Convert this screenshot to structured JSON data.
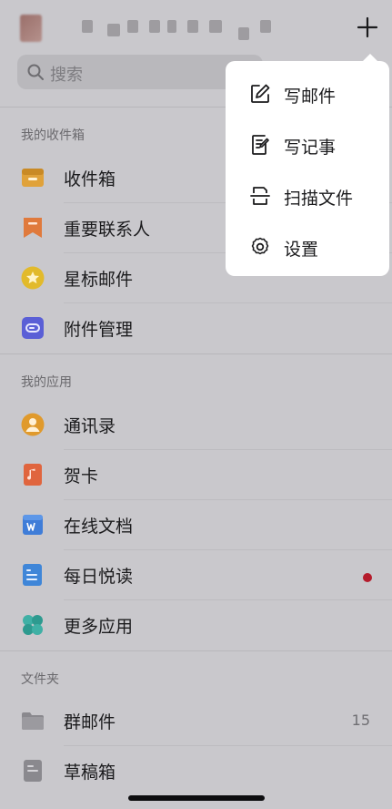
{
  "header": {
    "account_name": "",
    "add_icon": "plus-icon"
  },
  "search": {
    "placeholder": "搜索",
    "icon": "search-icon"
  },
  "sections": {
    "inbox": {
      "title": "我的收件箱",
      "items": [
        {
          "label": "收件箱",
          "icon": "inbox-tray-icon",
          "color": "#e0a23a"
        },
        {
          "label": "重要联系人",
          "icon": "bookmark-icon",
          "color": "#e07a3c"
        },
        {
          "label": "星标邮件",
          "icon": "star-icon",
          "color": "#e2ba2b"
        },
        {
          "label": "附件管理",
          "icon": "attachment-icon",
          "color": "#5a5fd6"
        }
      ]
    },
    "apps": {
      "title": "我的应用",
      "items": [
        {
          "label": "通讯录",
          "icon": "contacts-icon",
          "color": "#e09a2c"
        },
        {
          "label": "贺卡",
          "icon": "greeting-card-icon",
          "color": "#e0653e"
        },
        {
          "label": "在线文档",
          "icon": "word-doc-icon",
          "color": "#3f7dd8"
        },
        {
          "label": "每日悦读",
          "icon": "daily-read-icon",
          "color": "#3f86d8",
          "badge": "red-dot"
        },
        {
          "label": "更多应用",
          "icon": "more-apps-icon",
          "color": "#3fb0a5"
        }
      ]
    },
    "folders": {
      "title": "文件夹",
      "items": [
        {
          "label": "群邮件",
          "icon": "folder-icon",
          "count": "15"
        },
        {
          "label": "草稿箱",
          "icon": "draft-icon"
        }
      ]
    }
  },
  "popup_menu": {
    "items": [
      {
        "label": "写邮件",
        "icon": "compose-icon"
      },
      {
        "label": "写记事",
        "icon": "note-icon"
      },
      {
        "label": "扫描文件",
        "icon": "scan-icon"
      },
      {
        "label": "设置",
        "icon": "gear-icon"
      }
    ]
  }
}
